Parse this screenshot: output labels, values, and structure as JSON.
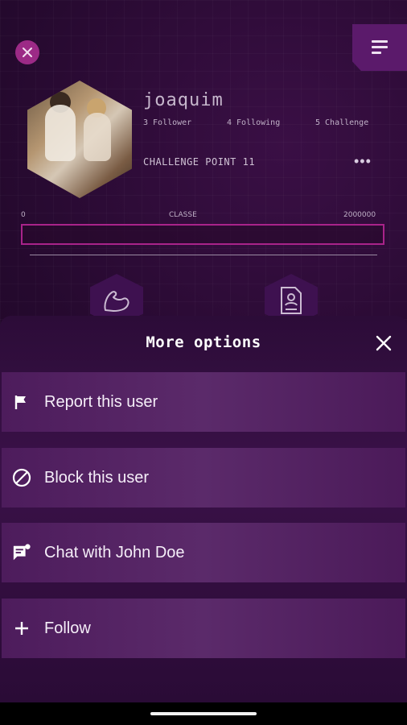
{
  "profile": {
    "username": "joaquim",
    "followers": "3 Follower",
    "following": "4 Following",
    "challenges": "5 Challenge",
    "challenge_point": "CHALLENGE POINT 11",
    "more_dots": "•••",
    "progress": {
      "min_label": "0",
      "mid_label": "CLASSE",
      "max_label": "2000000",
      "value": 11,
      "max": 2000000
    }
  },
  "sheet": {
    "title": "More options",
    "options": [
      {
        "label": "Report this user",
        "icon": "flag-icon"
      },
      {
        "label": "Block this user",
        "icon": "block-icon"
      },
      {
        "label": "Chat with John Doe",
        "icon": "chat-icon"
      },
      {
        "label": "Follow",
        "icon": "plus-icon"
      }
    ]
  },
  "colors": {
    "accent": "#a9238a",
    "background": "#25092e",
    "sheet": "#3a1148"
  }
}
